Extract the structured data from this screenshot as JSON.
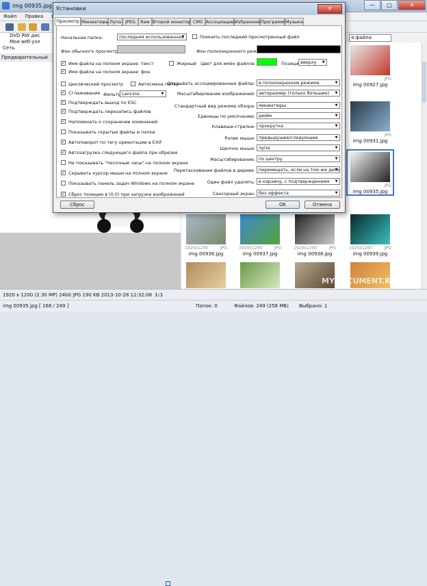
{
  "window": {
    "title": "img 00935.jpg  -  F",
    "minimize": "—",
    "maximize": "□",
    "close": "✕"
  },
  "menu": [
    "Файл",
    "Правка",
    "Цвета"
  ],
  "tree": [
    "DVD RW дис",
    "Мои веб-узл",
    "Сеть"
  ],
  "preview_header": "Предварительный просмо",
  "sort_label": "я файла",
  "thumbs": [
    {
      "res": "",
      "fmt": "",
      "name": "",
      "color": "#e8e8e8",
      "accent": "#c0392b"
    },
    {
      "res": "",
      "fmt": "JPG",
      "name": "img 00927.jpg",
      "color": "#6a8a6a",
      "accent": "#a8c8a0"
    },
    {
      "res": "",
      "fmt": "JPG",
      "name": "img 00931.jpg",
      "color": "#2a3a4a",
      "accent": "#8ab0d0"
    },
    {
      "res": "",
      "fmt": "JPG",
      "name": "img 00935.jpg",
      "color": "#f4f4f4",
      "accent": "#222"
    },
    {
      "res": "1920x1200",
      "fmt": "JPG",
      "name": "img 00936.jpg",
      "color": "#a8b8c8",
      "accent": "#7a8a6a"
    },
    {
      "res": "1920x1200",
      "fmt": "JPG",
      "name": "img 00937.jpg",
      "color": "#3a8ac8",
      "accent": "#5aa040"
    },
    {
      "res": "1920x1200",
      "fmt": "JPG",
      "name": "img 00938.jpg",
      "color": "#222",
      "accent": "#ccc"
    },
    {
      "res": "1920x1200",
      "fmt": "JPG",
      "name": "img 00939.jpg",
      "color": "#0a2a2a",
      "accent": "#3ac0c0"
    },
    {
      "res": "",
      "fmt": "",
      "name": "",
      "color": "#b08a60",
      "accent": "#e8d0a0"
    },
    {
      "res": "",
      "fmt": "",
      "name": "",
      "color": "#6a9a4a",
      "accent": "#d8e8c0"
    },
    {
      "res": "",
      "fmt": "",
      "name": "",
      "color": "#b8a890",
      "accent": "#5a4a30"
    },
    {
      "res": "",
      "fmt": "",
      "name": "",
      "color": "#d08040",
      "accent": "#f0c060"
    }
  ],
  "status": {
    "dims": "1920 x 1200 (2.30 MP)  24bit  JPG   190 KB   2013-10-28 12:32:08",
    "zoom": "1:1",
    "file": "img 00935.jpg [ 168 / 249 ]",
    "folders": "Папок: 0",
    "files": "Файлов: 249 (258 MB)",
    "selected": "Выбрано: 1"
  },
  "watermark": "MYDOCUMENT.RU",
  "dialog": {
    "title": "Установки",
    "close": "✕",
    "tabs": [
      "Просмотр",
      "Миниатюры",
      "Лупа",
      "JPEG",
      "Raw",
      "Второй монитор",
      "CMS",
      "Ассоциации",
      "Избранное",
      "Программы",
      "Музыка"
    ],
    "start_folder_label": "Начальная папка:",
    "start_folder_value": "последняя использованная",
    "remember_last_label": "Помнить последний просмотренный файл",
    "bg_normal_label": "Фон обычного просмотра:",
    "bg_fullscreen_label": "Фон полноэкранного режима:",
    "colors": {
      "bg_normal": "#c8c8c8",
      "bg_fullscreen": "#000000",
      "name_color": "#00ff00"
    },
    "left_checks": [
      {
        "label": "Имя файла на полном экране: текст",
        "on": true
      },
      {
        "label": "Имя файла на полном экране: фон",
        "on": true
      },
      {
        "label": "Циклический просмотр",
        "on": false
      },
      {
        "label": "Сглаживание",
        "on": true
      },
      {
        "label": "Подтверждать выход по ESC",
        "on": true
      },
      {
        "label": "Подтверждать перезапись файлов",
        "on": true
      },
      {
        "label": "Напоминать о сохранении изменений",
        "on": true
      },
      {
        "label": "Показывать скрытые файлы и папки",
        "on": false
      },
      {
        "label": "Автоповорот по тегу ориентации в EXIF",
        "on": true
      },
      {
        "label": "Автозагрузка следующего файла при обрезке",
        "on": true
      },
      {
        "label": "Не показывать \"песочные часы\" на полном экране",
        "on": false
      },
      {
        "label": "Скрывать курсор мыши на полном экране",
        "on": true
      },
      {
        "label": "Показывать панель задач Windows на полном экране",
        "on": false
      },
      {
        "label": "Сброс позиции в (0,0) при загрузке изображений",
        "on": true
      }
    ],
    "bold_label": "Жирный",
    "bold_on": false,
    "autosize_folder_label": "Автосмена папки",
    "autosize_folder_on": false,
    "filter_label": "Фильтр:",
    "filter_value": "Lanczos",
    "name_color_label": "Цвет для имён файлов:",
    "position_label": "Позиция:",
    "position_value": "вверху",
    "right_rows": [
      {
        "label": "Открывать ассоциированные файлы:",
        "value": "в полноэкранном режиме"
      },
      {
        "label": "Масштабирование изображений:",
        "value": "авторазмер (только большие)"
      },
      {
        "label": "Стандартный вид режима обзора:",
        "value": "миниатюры"
      },
      {
        "label": "Единицы по умолчанию:",
        "value": "дюйм"
      },
      {
        "label": "Клавиши-стрелки:",
        "value": "прокрутка"
      },
      {
        "label": "Ролик мыши:",
        "value": "предыдущее/следующее"
      },
      {
        "label": "Щелчок мыши:",
        "value": "лупа"
      },
      {
        "label": "Масштабирование:",
        "value": "по центру"
      },
      {
        "label": "Перетаскивание файлов в дереве:",
        "value": "перемещать, если на том же диске"
      },
      {
        "label": "Один файл удалять:",
        "value": "в корзину, с подтверждением"
      },
      {
        "label": "Сенсорный экран:",
        "value": "без эффекта"
      }
    ],
    "reset_button": "Сброс",
    "ok_button": "OK",
    "cancel_button": "Отмена"
  }
}
